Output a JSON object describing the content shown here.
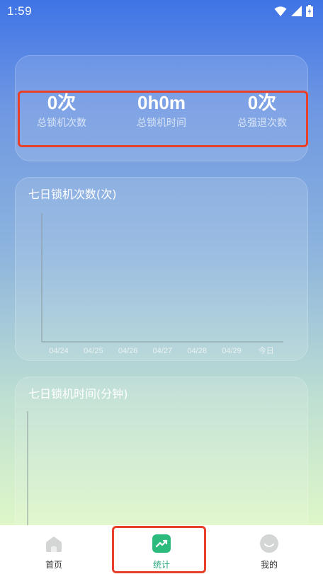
{
  "status_bar": {
    "time": "1:59",
    "icons": [
      "wifi-icon",
      "signal-icon",
      "battery-icon"
    ]
  },
  "summary": {
    "items": [
      {
        "value": "0次",
        "label": "总锁机次数"
      },
      {
        "value": "0h0m",
        "label": "总锁机时间"
      },
      {
        "value": "0次",
        "label": "总强退次数"
      }
    ]
  },
  "charts": {
    "weekly_count_title": "七日锁机次数(次)",
    "weekly_time_title": "七日锁机时间(分钟)"
  },
  "chart_data": [
    {
      "type": "line",
      "title": "七日锁机次数(次)",
      "categories": [
        "04/24",
        "04/25",
        "04/26",
        "04/27",
        "04/28",
        "04/29",
        "今日"
      ],
      "series": []
    },
    {
      "type": "line",
      "title": "七日锁机时间(分钟)",
      "categories": [],
      "series": []
    }
  ],
  "bottom_nav": {
    "items": [
      {
        "label": "首页",
        "icon": "home-icon",
        "active": false
      },
      {
        "label": "统计",
        "icon": "trend-up-icon",
        "active": true
      },
      {
        "label": "我的",
        "icon": "profile-icon",
        "active": false
      }
    ]
  },
  "colors": {
    "highlight": "#e8402a",
    "active_tab": "#27a57c"
  }
}
